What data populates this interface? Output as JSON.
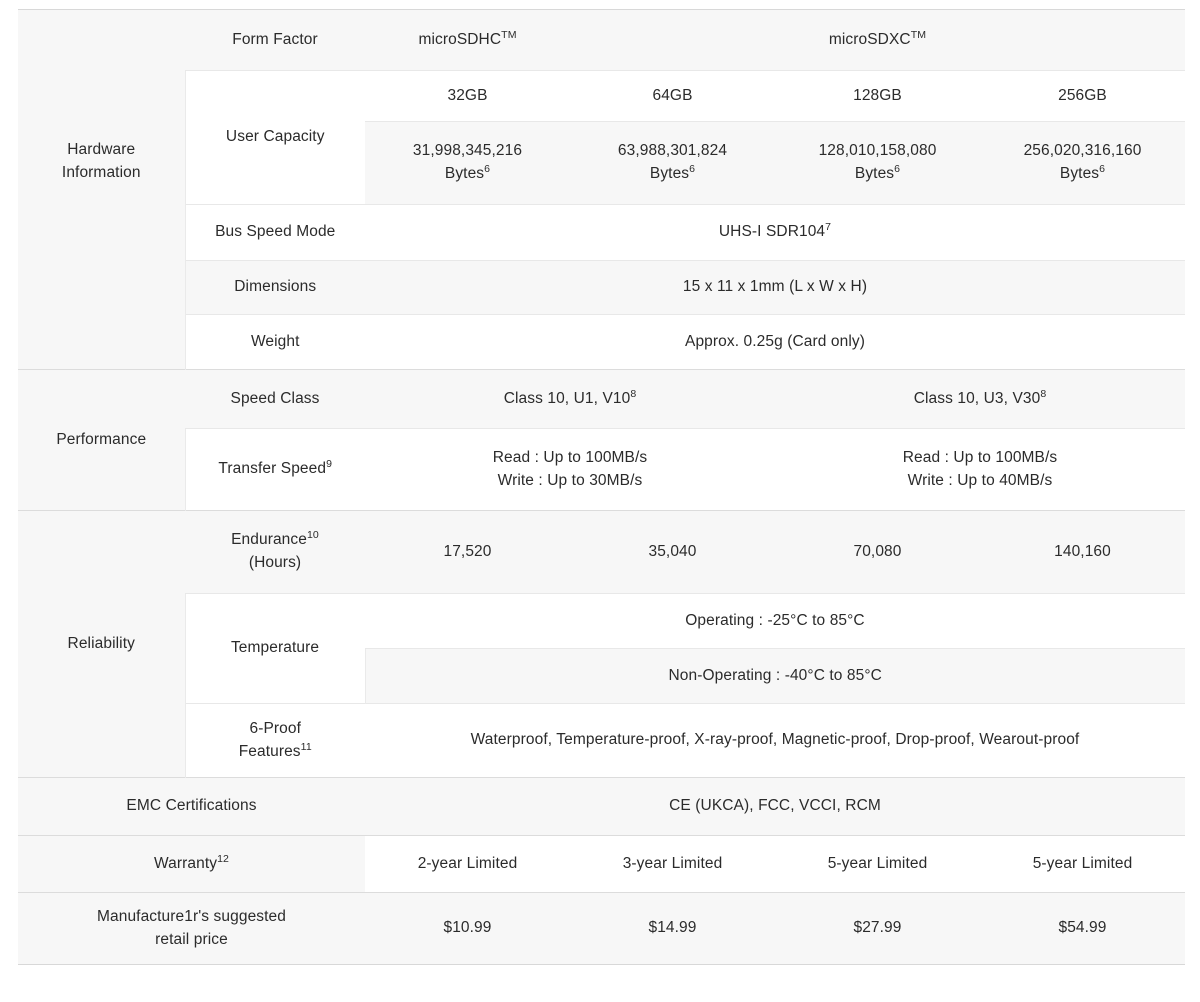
{
  "table": {
    "categories": {
      "hardware": "Hardware\nInformation",
      "hardware_line1": "Hardware",
      "hardware_line2": "Information",
      "performance": "Performance",
      "reliability": "Reliability",
      "emc": "EMC Certifications",
      "warranty": "Warranty",
      "warranty_sup": "12",
      "msrp_line1": "Manufacture1r's suggested",
      "msrp_line2": "retail price"
    },
    "rows": {
      "form_factor": {
        "label": "Form Factor",
        "sdhc": "microSDHC",
        "sdhc_sup": "TM",
        "sdxc": "microSDXC",
        "sdxc_sup": "TM"
      },
      "user_capacity": {
        "label": "User Capacity",
        "sizes": [
          "32GB",
          "64GB",
          "128GB",
          "256GB"
        ],
        "bytes": [
          "31,998,345,216",
          "63,988,301,824",
          "128,010,158,080",
          "256,020,316,160"
        ],
        "bytes_unit": "Bytes",
        "bytes_sup": "6"
      },
      "bus_speed": {
        "label": "Bus Speed Mode",
        "value": "UHS-I SDR104",
        "value_sup": "7"
      },
      "dimensions": {
        "label": "Dimensions",
        "value": "15 x 11 x 1mm (L x W x H)"
      },
      "weight": {
        "label": "Weight",
        "value": "Approx. 0.25g (Card only)"
      },
      "speed_class": {
        "label": "Speed Class",
        "sdhc_value": "Class 10, U1, V10",
        "sdhc_sup": "8",
        "sdxc_value": "Class 10, U3, V30",
        "sdxc_sup": "8"
      },
      "transfer_speed": {
        "label": "Transfer Speed",
        "label_sup": "9",
        "sdhc_read": "Read : Up to 100MB/s",
        "sdhc_write": "Write : Up to 30MB/s",
        "sdxc_read": "Read : Up to 100MB/s",
        "sdxc_write": "Write : Up to 40MB/s"
      },
      "endurance": {
        "label_line1": "Endurance",
        "label_sup": "10",
        "label_line2": "(Hours)",
        "values": [
          "17,520",
          "35,040",
          "70,080",
          "140,160"
        ]
      },
      "temperature": {
        "label": "Temperature",
        "operating": "Operating : -25°C to 85°C",
        "non_operating": "Non-Operating : -40°C to 85°C"
      },
      "six_proof": {
        "label_line1": "6-Proof",
        "label_line2": "Features",
        "label_sup": "11",
        "value": "Waterproof, Temperature-proof, X-ray-proof, Magnetic-proof, Drop-proof, Wearout-proof"
      },
      "emc": {
        "label": "EMC Certifications",
        "value": "CE (UKCA), FCC, VCCI, RCM"
      },
      "warranty": {
        "values": [
          "2-year Limited",
          "3-year Limited",
          "5-year Limited",
          "5-year Limited"
        ]
      },
      "msrp": {
        "values": [
          "$10.99",
          "$14.99",
          "$27.99",
          "$54.99"
        ]
      }
    }
  },
  "colors": {
    "text": "#2b2b2b",
    "row_gray": "#f7f7f7",
    "row_white": "#ffffff",
    "border": "#e8e8e8",
    "section_border": "#dcdcdc"
  }
}
